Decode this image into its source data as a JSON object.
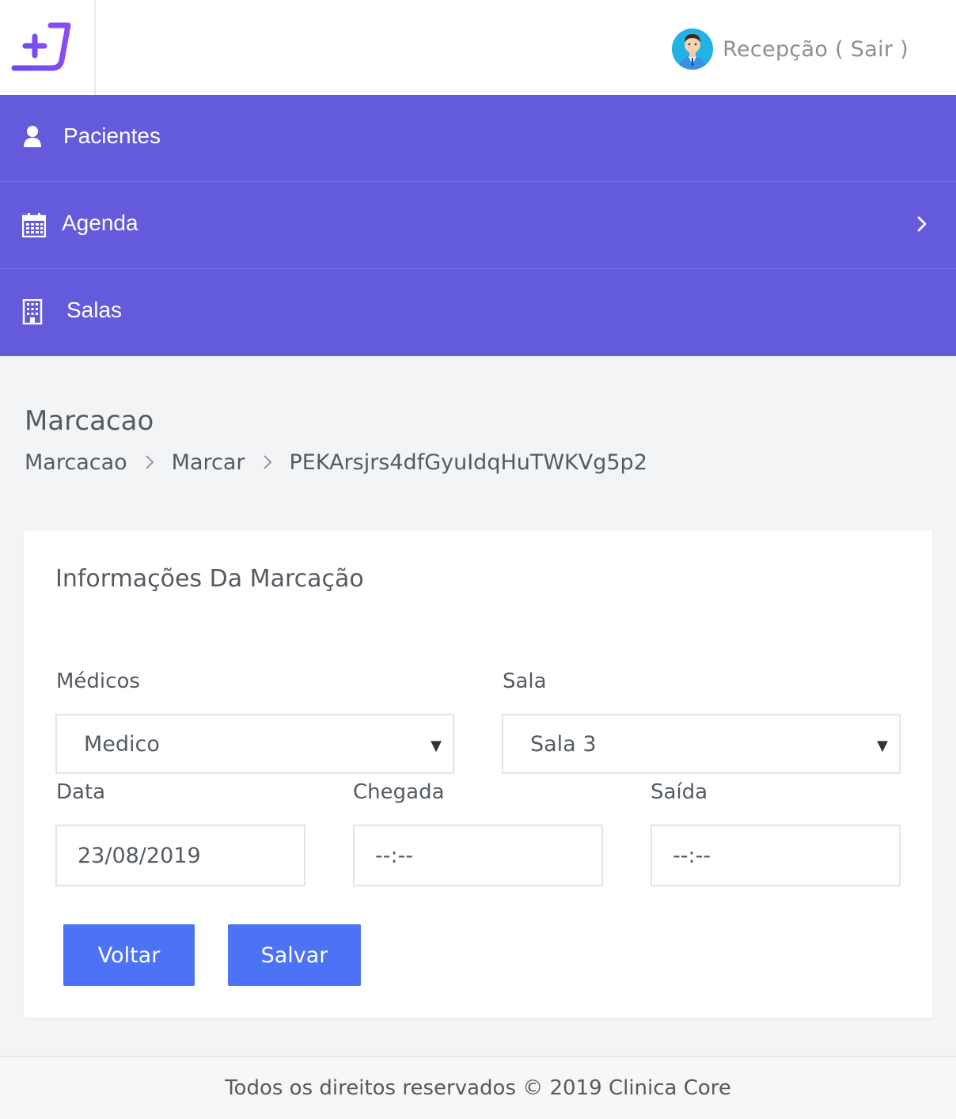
{
  "header": {
    "user_label": "Recepção ( Sair )"
  },
  "nav": {
    "items": [
      {
        "label": "Pacientes",
        "icon": "user-icon"
      },
      {
        "label": "Agenda",
        "icon": "calendar-icon"
      },
      {
        "label": "Salas",
        "icon": "building-icon"
      }
    ]
  },
  "page": {
    "title": "Marcacao",
    "breadcrumb": [
      "Marcacao",
      "Marcar",
      "PEKArsjrs4dfGyuIdqHuTWKVg5p2"
    ]
  },
  "form": {
    "title": "Informações Da Marcação",
    "medicos_label": "Médicos",
    "medicos_value": "Medico",
    "sala_label": "Sala",
    "sala_value": "Sala 3",
    "data_label": "Data",
    "data_value": "23/08/2019",
    "chegada_label": "Chegada",
    "chegada_value": "--:--",
    "saida_label": "Saída",
    "saida_value": "--:--",
    "back_label": "Voltar",
    "save_label": "Salvar"
  },
  "footer": {
    "text": "Todos os direitos reservados © 2019 Clinica Core"
  },
  "colors": {
    "nav_bg": "#635bdb",
    "button_bg": "#4c73f5",
    "logo_accent": "#6a4cf0"
  }
}
